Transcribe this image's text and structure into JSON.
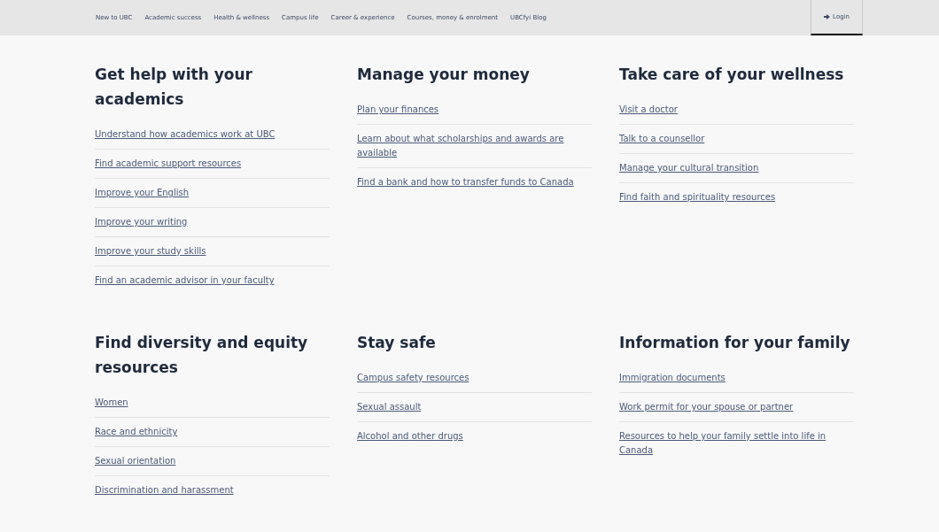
{
  "nav": {
    "items": [
      "New to UBC",
      "Academic success",
      "Health & wellness",
      "Campus life",
      "Career & experience",
      "Courses, money & enrolment",
      "UBCfyi Blog"
    ],
    "login": "Login"
  },
  "sections": [
    {
      "title": "Get help with your academics",
      "links": [
        "Understand how academics work at UBC",
        "Find academic support resources",
        "Improve your English",
        "Improve your writing",
        "Improve your study skills",
        "Find an academic advisor in your faculty"
      ]
    },
    {
      "title": "Manage your money",
      "links": [
        "Plan your finances",
        "Learn about what scholarships and awards are available",
        "Find a bank and how to transfer funds to Canada"
      ]
    },
    {
      "title": "Take care of your wellness",
      "links": [
        "Visit a doctor",
        "Talk to a counsellor",
        "Manage your cultural transition",
        "Find faith and spirituality resources"
      ]
    },
    {
      "title": "Find diversity and equity resources",
      "links": [
        "Women",
        "Race and ethnicity",
        "Sexual orientation",
        "Discrimination and harassment"
      ]
    },
    {
      "title": "Stay safe",
      "links": [
        "Campus safety resources",
        "Sexual assault",
        "Alcohol and other drugs"
      ]
    },
    {
      "title": "Information for your family",
      "links": [
        "Immigration documents",
        "Work permit for your spouse or partner",
        "Resources to help your family settle into life in Canada"
      ]
    }
  ]
}
